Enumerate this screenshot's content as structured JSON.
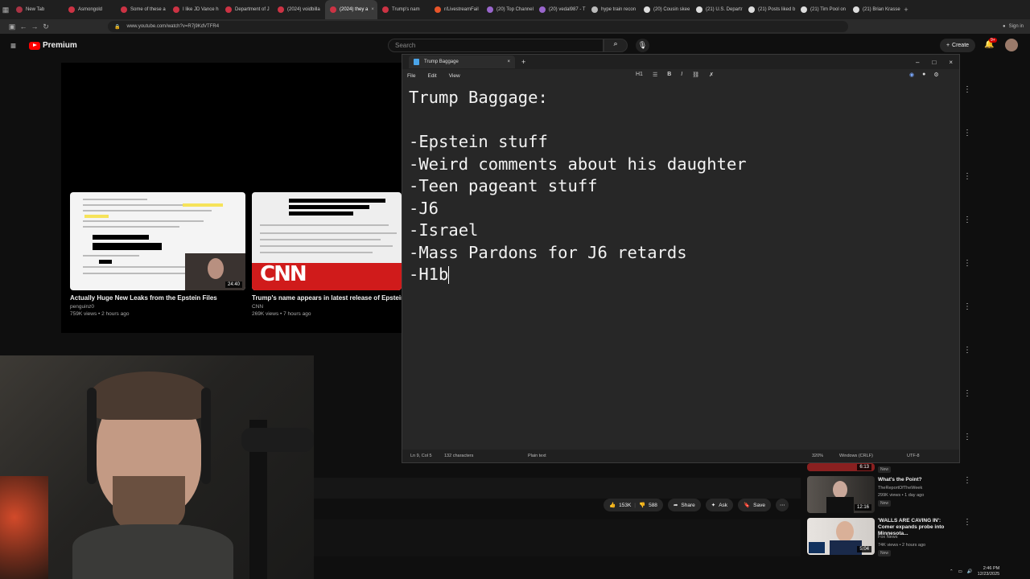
{
  "browser": {
    "tabs": [
      {
        "label": "New Tab",
        "color": "#aa3344",
        "active": false
      },
      {
        "label": "Asmongold",
        "color": "#cc3344",
        "active": false
      },
      {
        "label": "Some of these a",
        "color": "#cc3344",
        "active": false
      },
      {
        "label": "I like JD Vance h",
        "color": "#cc3344",
        "active": false
      },
      {
        "label": "Department of J",
        "color": "#cc3344",
        "active": false
      },
      {
        "label": "(2024) voidbilla",
        "color": "#cc3344",
        "active": false
      },
      {
        "label": "(2024) they a",
        "color": "#cc3344",
        "active": true
      },
      {
        "label": "Trump's nam",
        "color": "#cc3344",
        "active": false
      },
      {
        "label": "r/LivestreamFail",
        "color": "#e8552a",
        "active": false
      },
      {
        "label": "(20) Top Channel",
        "color": "#9966cc",
        "active": false
      },
      {
        "label": "(20) vedal987 - T",
        "color": "#9966cc",
        "active": false
      },
      {
        "label": "hype train recon",
        "color": "#bbbbbb",
        "active": false
      },
      {
        "label": "(20) Cousin skee",
        "color": "#dddddd",
        "active": false
      },
      {
        "label": "(21) U.S. Departr",
        "color": "#dddddd",
        "active": false
      },
      {
        "label": "(21) Posts liked b",
        "color": "#dddddd",
        "active": false
      },
      {
        "label": "(21) Tim Pool on",
        "color": "#dddddd",
        "active": false
      },
      {
        "label": "(21) Brian Krasse",
        "color": "#dddddd",
        "active": false
      }
    ],
    "new_tab_glyph": "+",
    "url": "www.youtube.com/watch?v=R7j9KdVTFR4",
    "sign_in": "Sign in"
  },
  "youtube": {
    "brand": "Premium",
    "search_placeholder": "Search",
    "create_label": "Create",
    "notif_count": "9+",
    "videos": [
      {
        "title": "Actually Huge New Leaks from the Epstein Files",
        "channel": "penguinz0",
        "meta": "759K views • 2 hours ago",
        "duration": "24:40"
      },
      {
        "title": "Trump's name appears in latest release of Epstein",
        "channel": "CNN",
        "meta": "269K views • 7 hours ago",
        "logo_text": "CNN"
      }
    ],
    "actions": {
      "likes": "153K",
      "dislikes": "588",
      "share": "Share",
      "ask": "Ask",
      "save": "Save"
    },
    "sidebar": [
      {
        "title": "What's the Point?",
        "channel": "TheReportOfTheWeek",
        "meta": "299K views • 1 day ago",
        "badge": "New",
        "duration": "12:16"
      },
      {
        "title": "'WALLS ARE CAVING IN': Comer expands probe into Minnesota...",
        "channel": "Fox News",
        "meta": "74K views • 2 hours ago",
        "badge": "New",
        "duration": "5:04"
      }
    ],
    "sidebar_top_badge": "New",
    "sidebar_top_duration": "6:13"
  },
  "notepad": {
    "tab_title": "Trump Baggage",
    "menu": [
      "File",
      "Edit",
      "View"
    ],
    "heading_tool": "H1",
    "lines": [
      "Trump Baggage:",
      "",
      "-Epstein stuff",
      "-Weird comments about his daughter",
      "-Teen pageant stuff",
      "-J6",
      "-Israel",
      "-Mass Pardons for J6 retards",
      "-H1b"
    ],
    "status": {
      "position": "Ln 9, Col 5",
      "chars": "132 characters",
      "format": "Plain text",
      "zoom": "320%",
      "line_ending": "Windows (CRLF)",
      "encoding": "UTF-8"
    }
  },
  "taskbar": {
    "time": "2:46 PM",
    "date": "12/23/2025"
  }
}
